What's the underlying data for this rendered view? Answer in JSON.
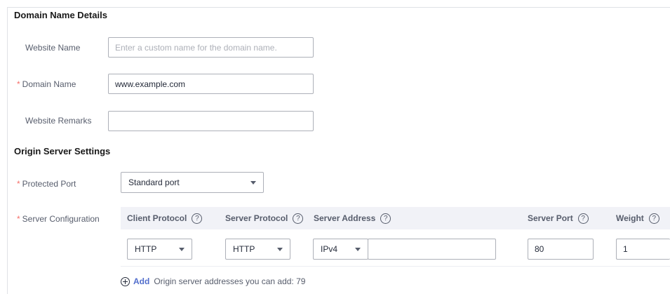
{
  "sections": {
    "domain_details": "Domain Name Details",
    "origin_settings": "Origin Server Settings"
  },
  "required_marker": "*",
  "fields": {
    "website_name": {
      "label": "Website Name",
      "value": "",
      "placeholder": "Enter a custom name for the domain name."
    },
    "domain_name": {
      "label": "Domain Name",
      "value": "www.example.com",
      "required": true
    },
    "website_remarks": {
      "label": "Website Remarks",
      "value": ""
    },
    "protected_port": {
      "label": "Protected Port",
      "value": "Standard port",
      "required": true
    },
    "server_configuration": {
      "label": "Server Configuration",
      "required": true
    }
  },
  "table": {
    "columns": [
      {
        "label": "Client Protocol",
        "help_icon": "help-icon"
      },
      {
        "label": "Server Protocol",
        "help_icon": "help-icon"
      },
      {
        "label": "Server Address",
        "help_icon": "help-icon"
      },
      {
        "label": "Server Port",
        "help_icon": "help-icon"
      },
      {
        "label": "Weight",
        "help_icon": "help-icon"
      }
    ],
    "help_glyph": "?",
    "rows": [
      {
        "client_protocol": "HTTP",
        "server_protocol": "HTTP",
        "address_type": "IPv4",
        "server_address": "",
        "server_port": "80",
        "weight": "1"
      }
    ]
  },
  "add": {
    "label": "Add",
    "note": "Origin server addresses you can add: 79"
  },
  "colors": {
    "accent": "#526ecc",
    "required": "#f66f6a",
    "header_bg": "#f1f2f7",
    "border": "#adb0b8"
  }
}
